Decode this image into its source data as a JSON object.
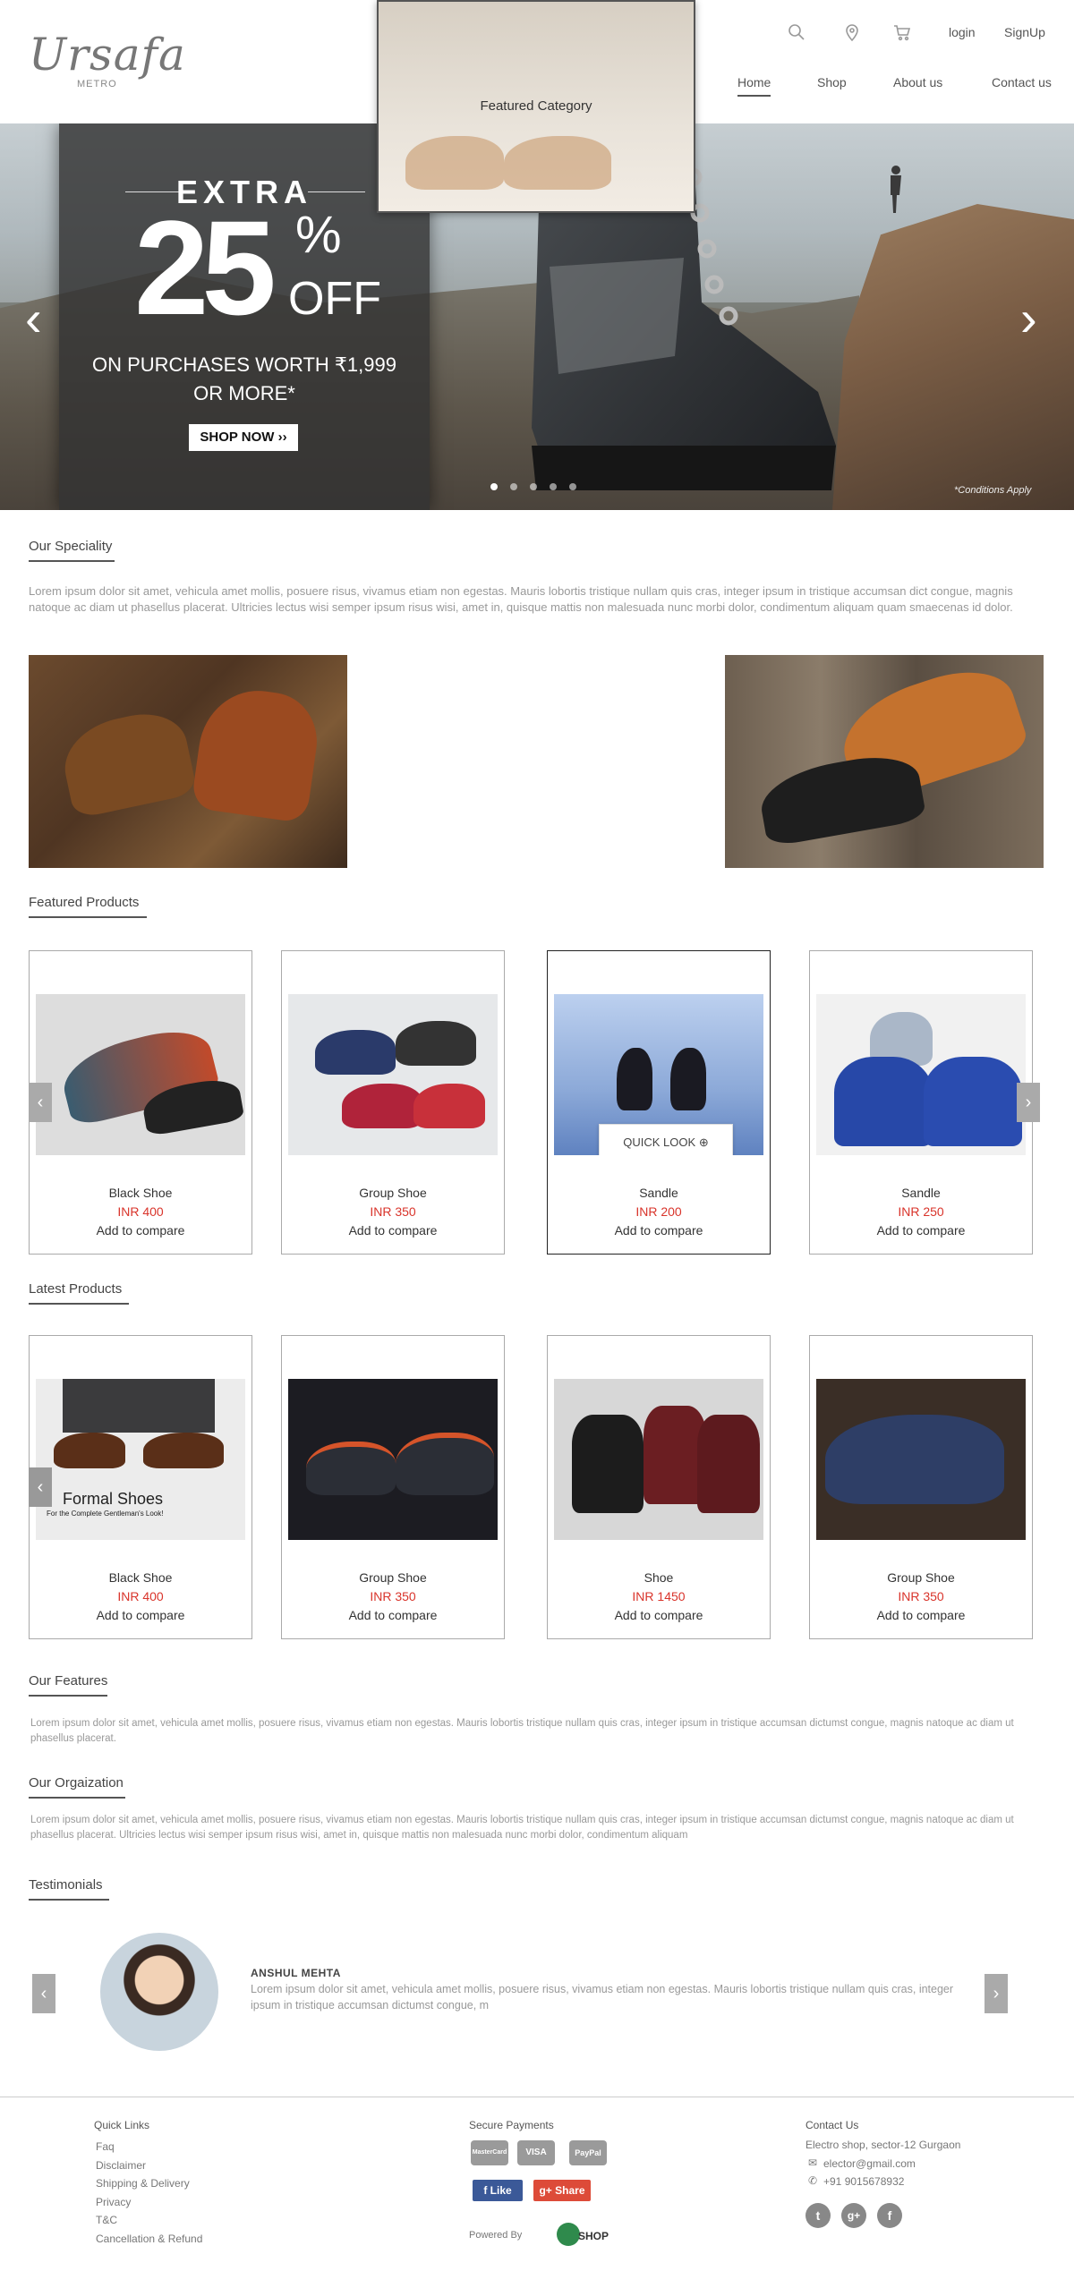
{
  "header": {
    "logo": "Ursafa",
    "logo_sub": "METRO",
    "login": "login",
    "signup": "SignUp",
    "nav": [
      "Home",
      "Shop",
      "About us",
      "Contact us"
    ]
  },
  "hero": {
    "extra": "EXTRA",
    "amount": "25",
    "percent": "%",
    "off": "OFF",
    "line1": "ON PURCHASES WORTH ₹1,999",
    "line2": "OR MORE*",
    "cta": "SHOP NOW ››",
    "condition": "*Conditions Apply",
    "prev": "‹",
    "next": "›",
    "slides": 5,
    "active_slide": 1
  },
  "speciality": {
    "title": "Our Speciality",
    "text": "Lorem ipsum dolor sit amet, vehicula amet mollis, posuere risus, vivamus etiam non egestas. Mauris lobortis tristique nullam quis cras, integer ipsum in tristique accumsan dict congue, magnis natoque ac diam ut phasellus placerat. Ultricies lectus wisi semper ipsum risus wisi, amet in, quisque mattis non malesuada nunc morbi dolor, condimentum aliquam quam smaecenas id dolor.",
    "featured_label": "Featured Category"
  },
  "featured": {
    "title": "Featured Products",
    "quick_look": "QUICK LOOK",
    "items": [
      {
        "name": "Black Shoe",
        "price": "INR 400",
        "compare": "Add to compare"
      },
      {
        "name": "Group Shoe",
        "price": "INR 350",
        "compare": "Add to compare"
      },
      {
        "name": "Sandle",
        "price": "INR 200",
        "compare": "Add to compare"
      },
      {
        "name": "Sandle",
        "price": "INR 250",
        "compare": "Add to compare"
      }
    ]
  },
  "latest": {
    "title": "Latest Products",
    "banner_text": "Formal Shoes",
    "banner_sub": "For the Complete Gentleman's Look!",
    "items": [
      {
        "name": "Black Shoe",
        "price": "INR 400",
        "compare": "Add to compare"
      },
      {
        "name": "Group Shoe",
        "price": "INR 350",
        "compare": "Add to compare"
      },
      {
        "name": "Shoe",
        "price": "INR 1450",
        "compare": "Add to compare"
      },
      {
        "name": "Group Shoe",
        "price": "INR 350",
        "compare": "Add to compare"
      }
    ]
  },
  "features": {
    "title": "Our Features",
    "text": "Lorem ipsum dolor sit amet, vehicula amet mollis, posuere risus, vivamus etiam non egestas. Mauris lobortis tristique nullam quis cras, integer ipsum in tristique accumsan dictumst congue, magnis natoque ac diam ut phasellus placerat."
  },
  "organization": {
    "title": "Our Orgaization",
    "text": "Lorem ipsum dolor sit amet, vehicula amet mollis, posuere risus, vivamus etiam non egestas. Mauris lobortis tristique nullam quis cras, integer ipsum in tristique accumsan dictumst congue, magnis natoque ac diam ut phasellus placerat. Ultricies lectus wisi semper ipsum risus wisi, amet in, quisque mattis non malesuada nunc morbi dolor, condimentum aliquam"
  },
  "testimonials": {
    "title": "Testimonials",
    "name": "ANSHUL MEHTA",
    "quote": "Lorem ipsum dolor sit amet, vehicula amet mollis, posuere risus, vivamus etiam non egestas. Mauris lobortis tristique nullam quis cras, integer ipsum in tristique accumsan dictumst congue, m"
  },
  "footer": {
    "quick_links_title": "Quick Links",
    "quick_links": [
      "Faq",
      "Disclaimer",
      "Shipping & Delivery",
      "Privacy",
      "T&C",
      "Cancellation & Refund"
    ],
    "payments_title": "Secure Payments",
    "payments": [
      "MasterCard",
      "VISA",
      "PayPal"
    ],
    "fb_like": "Like",
    "gplus_share": "Share",
    "powered_by": "Powered By",
    "powered_brand": "SHOP",
    "contact_title": "Contact Us",
    "address": "Electro shop, sector-12 Gurgaon",
    "email": "elector@gmail.com",
    "phone": "+91 9015678932"
  },
  "colors": {
    "accent_price": "#d9342b",
    "fb": "#3b5998",
    "gplus": "#dd4b39"
  }
}
